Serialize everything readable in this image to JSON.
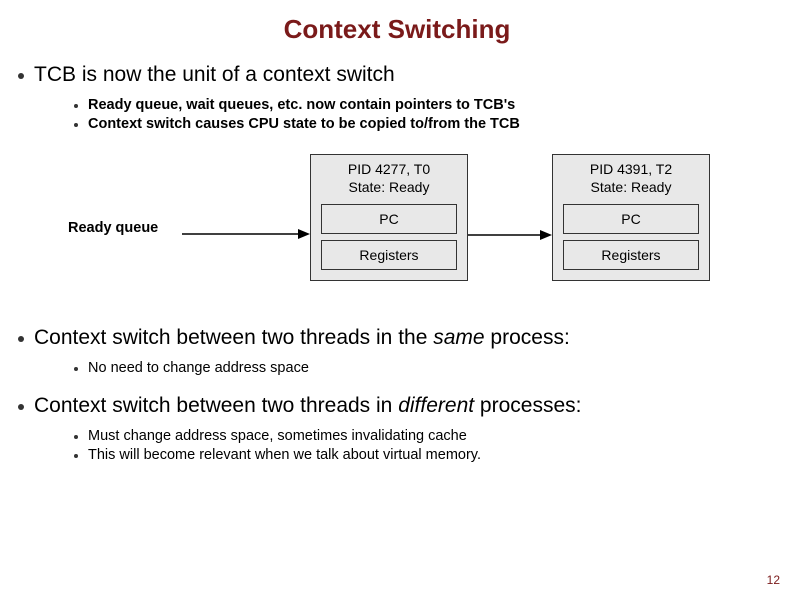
{
  "title": "Context Switching",
  "bullet1": {
    "text": "TCB is now the unit of a context switch",
    "subs": [
      "Ready queue, wait queues, etc. now contain pointers to TCB's",
      "Context switch causes CPU state to be copied to/from the TCB"
    ]
  },
  "diagram": {
    "ready_label": "Ready queue",
    "boxes": [
      {
        "line1": "PID 4277, T0",
        "line2": "State: Ready",
        "cell1": "PC",
        "cell2": "Registers"
      },
      {
        "line1": "PID 4391, T2",
        "line2": "State: Ready",
        "cell1": "PC",
        "cell2": "Registers"
      }
    ]
  },
  "bullet2": {
    "prefix": "Context switch between two threads in the ",
    "emph": "same",
    "suffix": " process:",
    "subs": [
      "No need to change address space"
    ]
  },
  "bullet3": {
    "prefix": "Context switch between two threads in ",
    "emph": "different",
    "suffix": " processes:",
    "subs": [
      "Must change address space, sometimes invalidating cache",
      "This will become relevant when we talk about virtual memory."
    ]
  },
  "page_number": "12"
}
